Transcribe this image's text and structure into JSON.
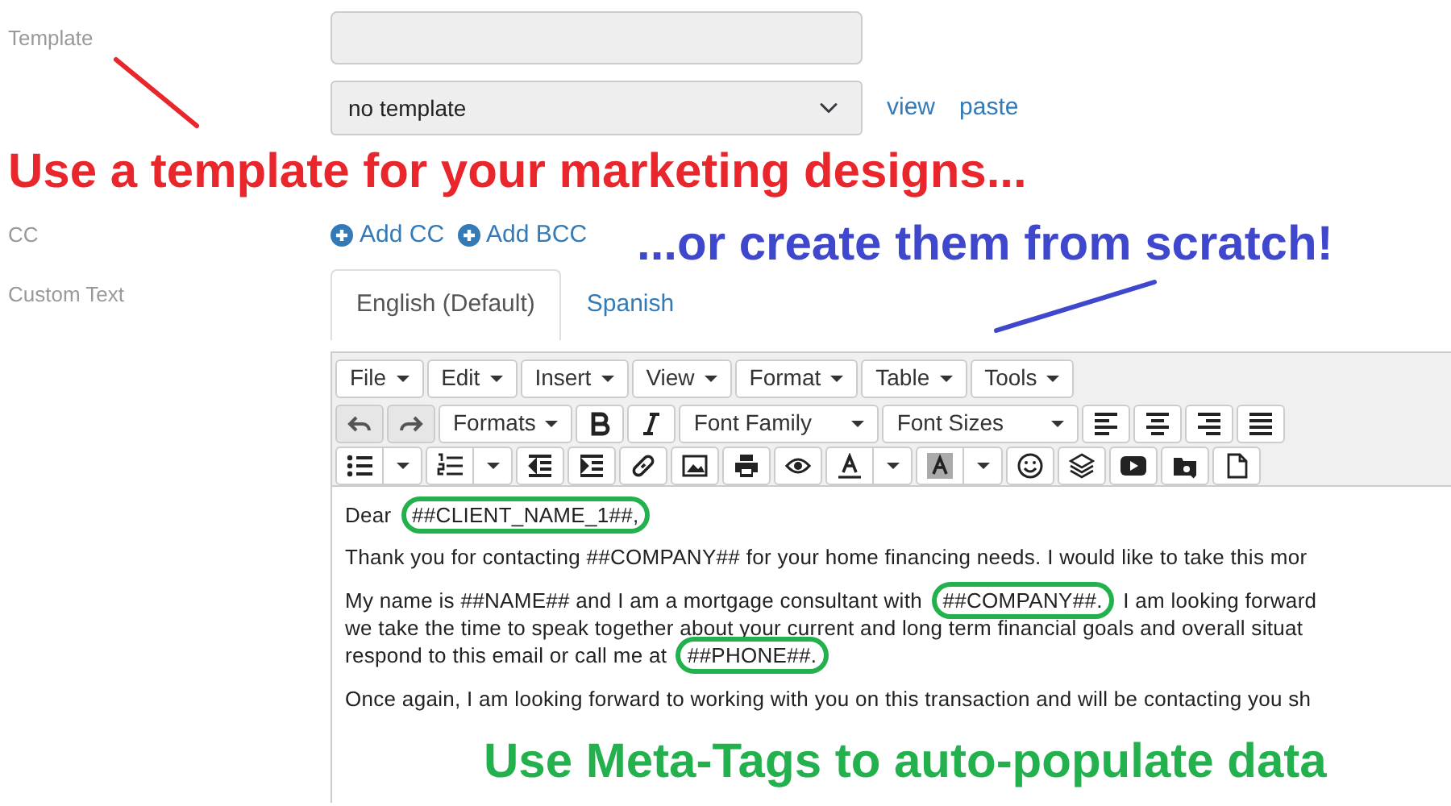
{
  "form": {
    "template_label": "Template",
    "template_select": {
      "value": "no template"
    },
    "template_links": [
      "view",
      "paste"
    ],
    "cc_label": "CC",
    "cc_links": [
      "Add CC",
      "Add BCC"
    ],
    "custom_text_label": "Custom Text"
  },
  "language_tabs": [
    {
      "label": "English (Default)",
      "selected": true
    },
    {
      "label": "Spanish",
      "selected": false
    }
  ],
  "editor": {
    "menus": [
      "File",
      "Edit",
      "Insert",
      "View",
      "Format",
      "Table",
      "Tools"
    ],
    "toolbar_rows": [
      [
        {
          "kind": "icon",
          "disabled": true
        },
        {
          "kind": "icon",
          "disabled": true
        },
        {
          "kind": "menu",
          "label": "Formats",
          "disabled": false
        },
        {
          "kind": "icon",
          "disabled": false
        },
        {
          "kind": "icon",
          "disabled": false
        },
        {
          "kind": "select",
          "label": "Font Family",
          "disabled": false
        },
        {
          "kind": "select",
          "label": "Font Sizes",
          "disabled": false
        },
        {
          "kind": "icon",
          "disabled": false
        },
        {
          "kind": "icon",
          "disabled": false
        },
        {
          "kind": "icon",
          "disabled": false
        },
        {
          "kind": "icon",
          "disabled": false
        }
      ],
      [
        {
          "kind": "split",
          "disabled": false
        },
        {
          "kind": "split",
          "disabled": false
        },
        {
          "kind": "icon",
          "disabled": false
        },
        {
          "kind": "icon",
          "disabled": false
        },
        {
          "kind": "icon",
          "disabled": false
        },
        {
          "kind": "icon",
          "disabled": false
        },
        {
          "kind": "icon",
          "disabled": false
        },
        {
          "kind": "icon",
          "disabled": false
        },
        {
          "kind": "split",
          "disabled": false
        },
        {
          "kind": "split",
          "disabled": false
        },
        {
          "kind": "icon",
          "disabled": false
        },
        {
          "kind": "icon",
          "disabled": false
        },
        {
          "kind": "icon",
          "disabled": false
        },
        {
          "kind": "icon",
          "disabled": false
        },
        {
          "kind": "icon",
          "disabled": false
        }
      ]
    ],
    "paragraphs": [
      [
        [
          {
            "text": "Dear ",
            "circled": false
          },
          {
            "text": "##CLIENT_NAME_1##,",
            "circled": true
          }
        ]
      ],
      [
        [
          {
            "text": "Thank you for contacting ##COMPANY## for your home financing needs. I would like to take this mor",
            "circled": false
          }
        ]
      ],
      [
        [
          {
            "text": "My name is ##NAME## and I am a mortgage consultant with ",
            "circled": false
          },
          {
            "text": "##COMPANY##.",
            "circled": true
          },
          {
            "text": " I am looking forward",
            "circled": false
          }
        ],
        [
          {
            "text": "we take the time to speak together about your current and long term financial goals and overall situat",
            "circled": false
          }
        ],
        [
          {
            "text": "respond to this email or call me at ",
            "circled": false
          },
          {
            "text": "##PHONE##.",
            "circled": true
          }
        ]
      ],
      [
        [
          {
            "text": "Once again, I am looking forward to working with you on this transaction and will be contacting you sh",
            "circled": false
          }
        ]
      ]
    ]
  },
  "annotations": [
    {
      "text": "Use a template for your marketing designs...",
      "color": "#e8262b"
    },
    {
      "text": "...or create them from scratch!",
      "color": "#3f48cc"
    },
    {
      "text": "Use Meta-Tags to auto-populate data",
      "color": "#22b14c"
    }
  ]
}
